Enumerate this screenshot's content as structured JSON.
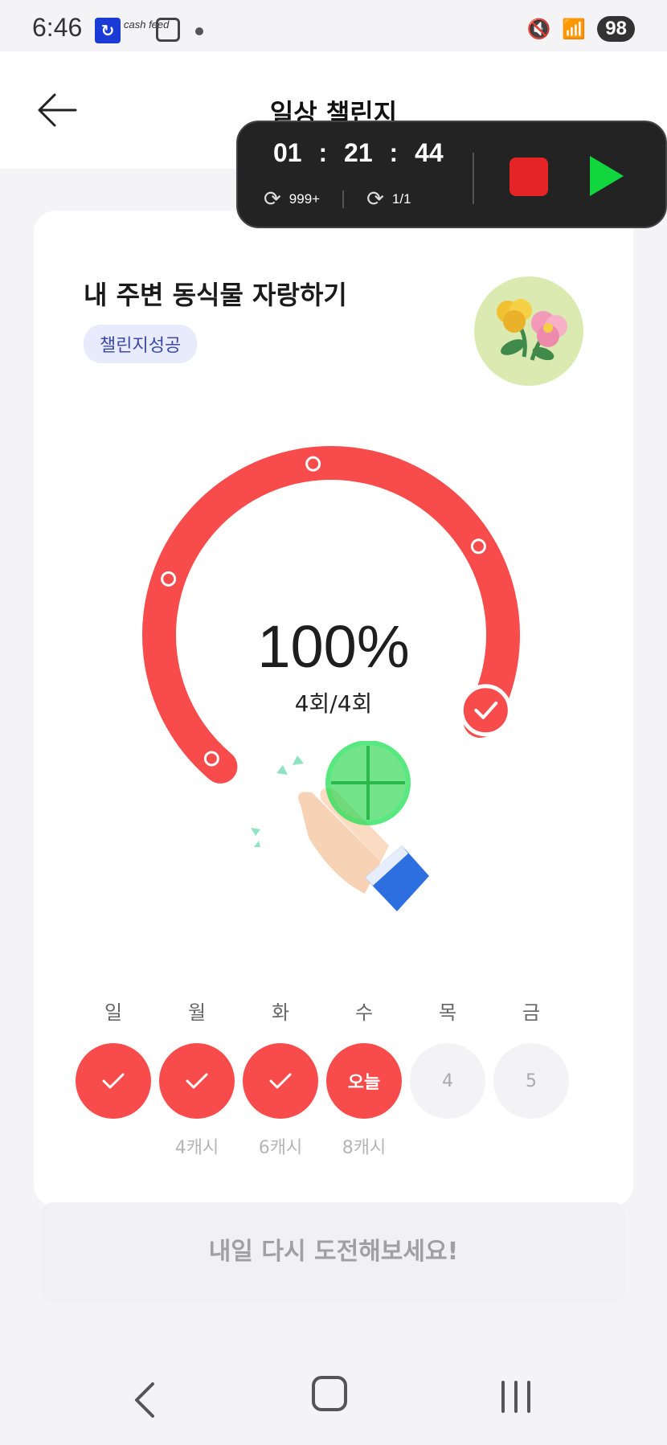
{
  "status_bar": {
    "time": "6:46",
    "app2_text": "cash feed",
    "battery": "98"
  },
  "header": {
    "title": "일상 챌린지"
  },
  "recorder": {
    "time": "01 : 21 : 44",
    "loop_count": "999+",
    "loop_progress": "1/1"
  },
  "challenge": {
    "title": "내 주변 동식물 자랑하기",
    "badge": "챌린지성공",
    "percent": "100%",
    "count": "4회/4회",
    "progress_fraction": 1.0
  },
  "days": [
    {
      "label": "일",
      "state": "done",
      "text": "",
      "reward": ""
    },
    {
      "label": "월",
      "state": "done",
      "text": "",
      "reward": "4캐시"
    },
    {
      "label": "화",
      "state": "done",
      "text": "",
      "reward": "6캐시"
    },
    {
      "label": "수",
      "state": "today",
      "text": "오늘",
      "reward": "8캐시"
    },
    {
      "label": "목",
      "state": "future",
      "text": "4",
      "reward": ""
    },
    {
      "label": "금",
      "state": "future",
      "text": "5",
      "reward": ""
    }
  ],
  "action_button": "내일 다시 도전해보세요!",
  "colors": {
    "accent": "#f84c4c",
    "badge_bg": "#e7ebfb",
    "recorder_stop": "#e52525",
    "recorder_play": "#12d63e"
  }
}
